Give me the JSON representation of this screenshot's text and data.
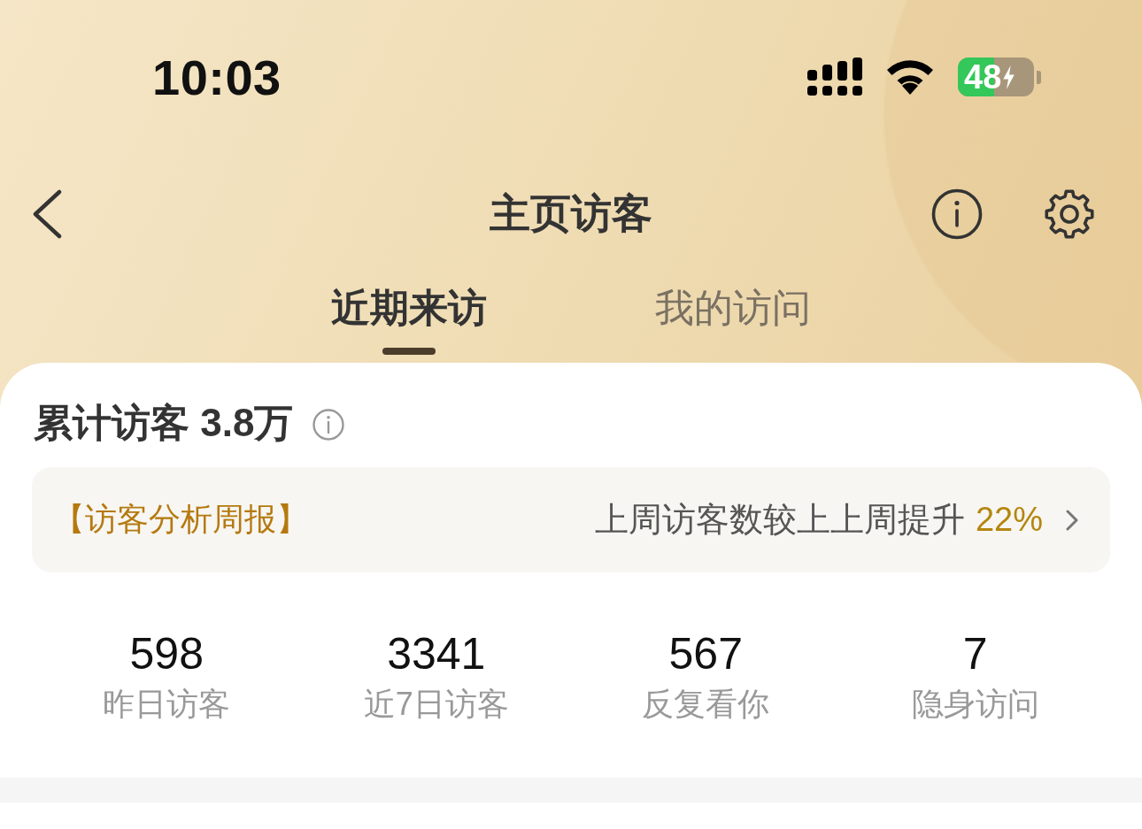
{
  "status_bar": {
    "time": "10:03",
    "battery": {
      "text": "48",
      "charging": true
    }
  },
  "nav": {
    "title": "主页访客"
  },
  "tabs": [
    {
      "label": "近期来访",
      "selected": true
    },
    {
      "label": "我的访问",
      "selected": false
    }
  ],
  "summary": {
    "text": "累计访客 3.8万"
  },
  "report": {
    "tag": "【访客分析周报】",
    "text": "上周访客数较上上周提升",
    "highlight": "22%"
  },
  "stats": [
    {
      "value": "598",
      "label": "昨日访客"
    },
    {
      "value": "3341",
      "label": "近7日访客"
    },
    {
      "value": "567",
      "label": "反复看你"
    },
    {
      "value": "7",
      "label": "隐身访问"
    }
  ]
}
